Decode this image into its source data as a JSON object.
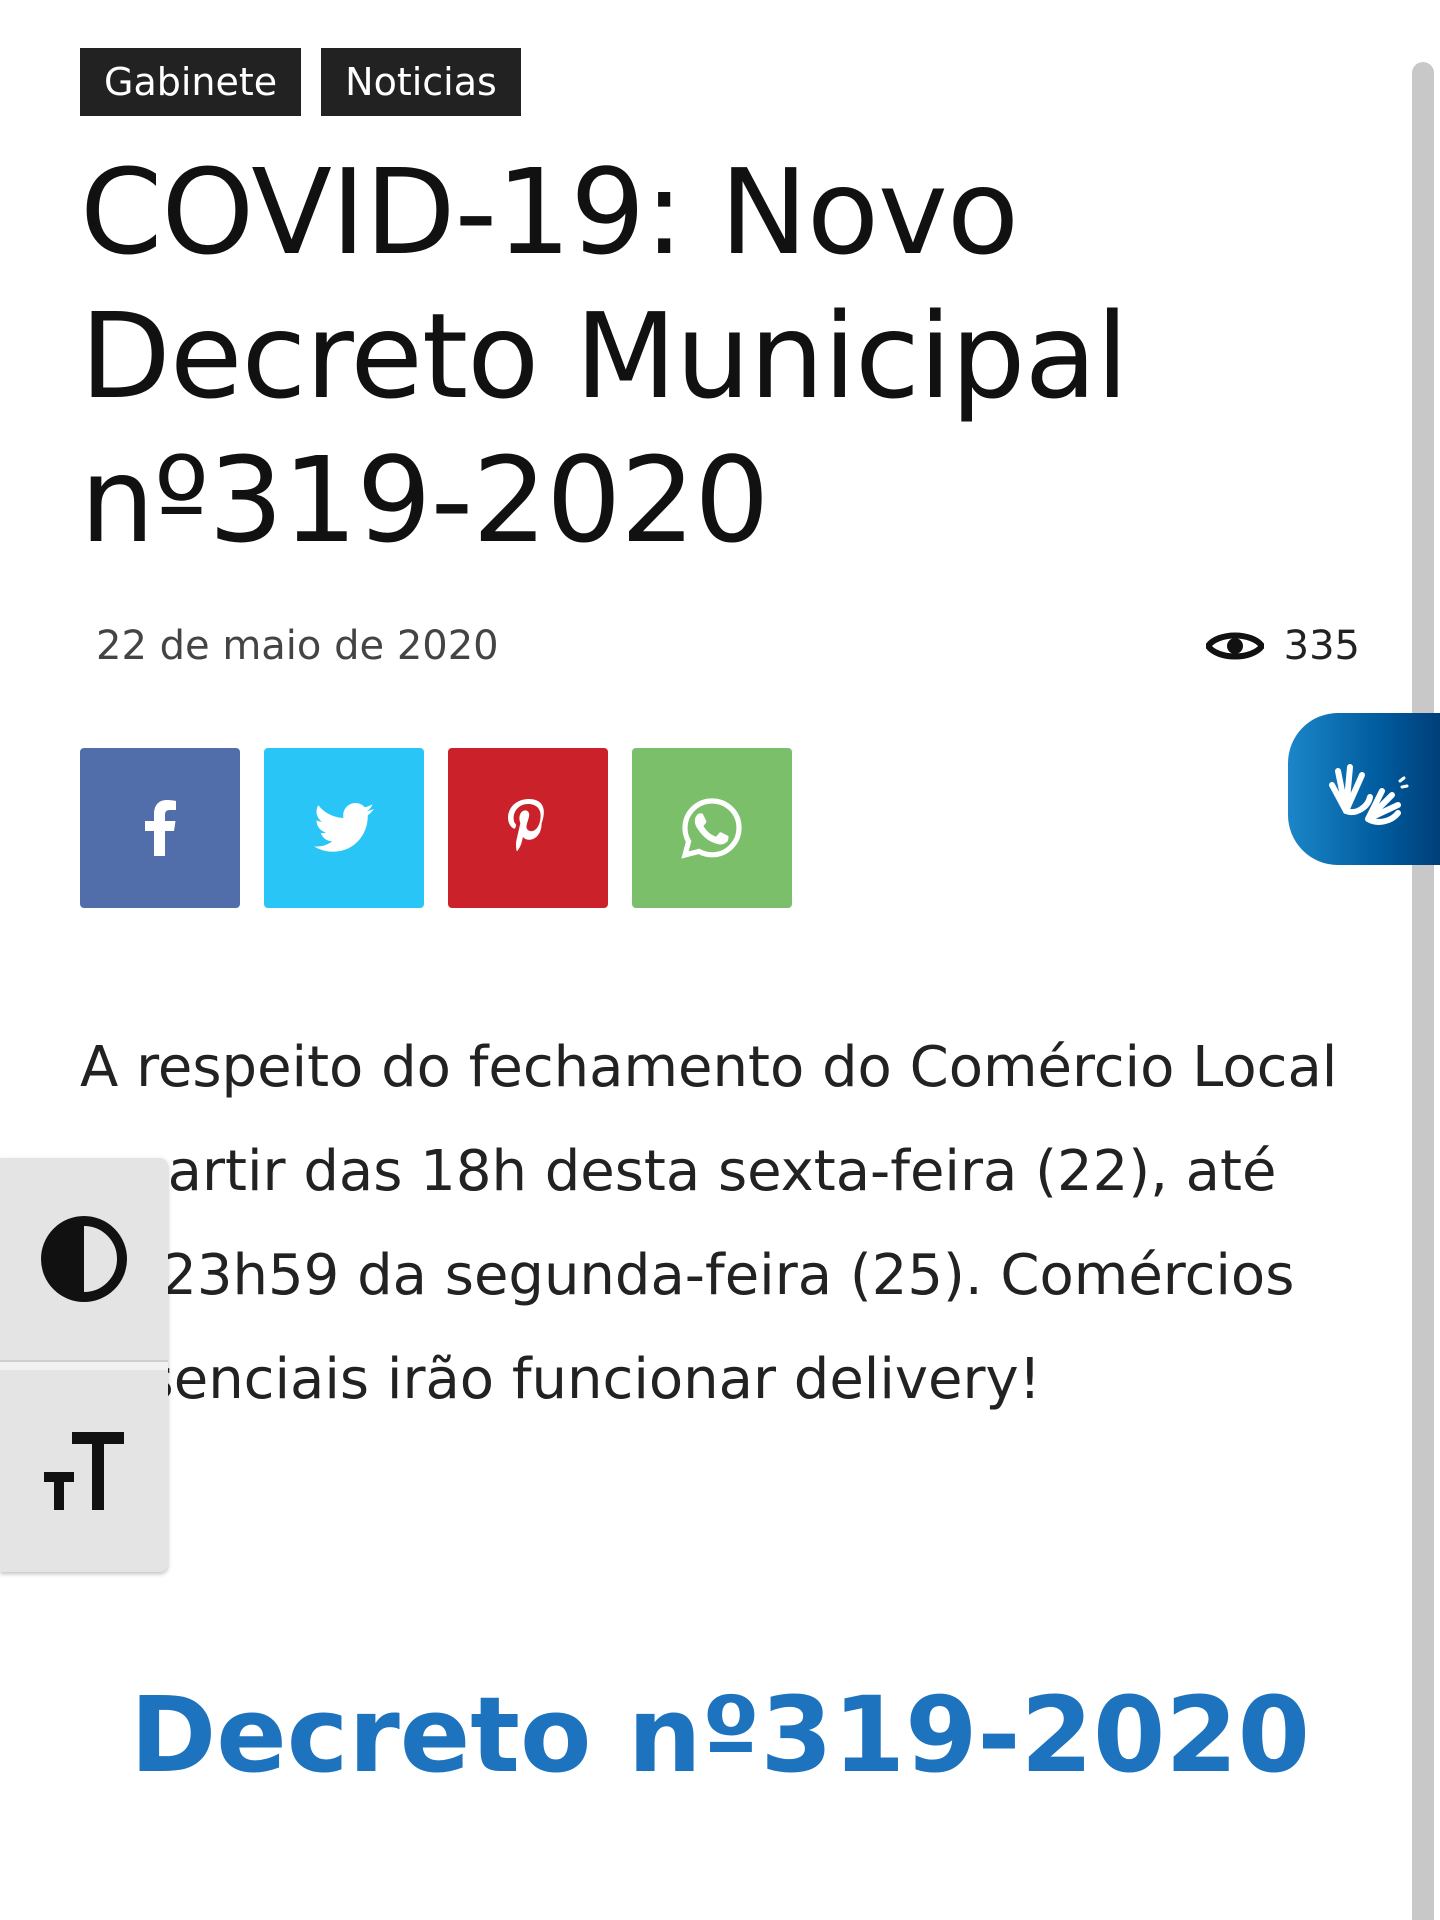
{
  "categories": [
    "Gabinete",
    "Noticias"
  ],
  "article": {
    "title": "COVID-19: Novo Decreto Municipal nº319-2020",
    "date": "22 de maio de 2020",
    "views": "335",
    "body": "A respeito do fechamento do Comércio Local a partir das 18h desta sexta-feira (22), até às 23h59 da segunda-feira (25). Comércios Essenciais irão funcionar delivery!",
    "decree_heading": "Decreto nº319-2020"
  },
  "share_buttons": [
    {
      "network": "facebook",
      "icon": "facebook-icon",
      "color": "#516eab"
    },
    {
      "network": "twitter",
      "icon": "twitter-icon",
      "color": "#29c5f6"
    },
    {
      "network": "pinterest",
      "icon": "pinterest-icon",
      "color": "#ca212a"
    },
    {
      "network": "whatsapp",
      "icon": "whatsapp-icon",
      "color": "#7bbf6a"
    }
  ],
  "accessibility": {
    "contrast_icon": "contrast-icon",
    "font_size_icon": "text-size-icon",
    "sign_language_icon": "sign-language-hands-icon"
  },
  "colors": {
    "tag_background": "#222222",
    "heading_blue": "#1e73be",
    "vlibras_blue": "#005c9e"
  }
}
